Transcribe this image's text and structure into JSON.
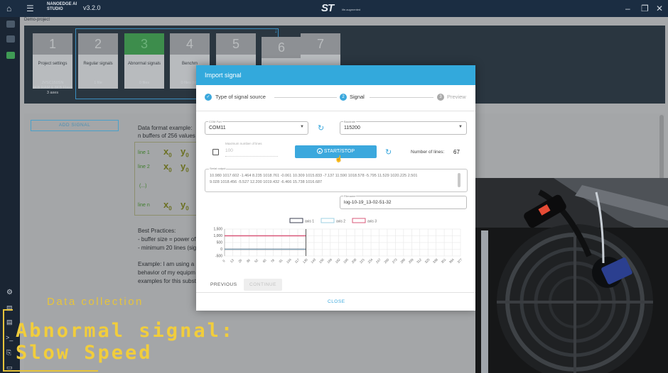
{
  "app": {
    "brand_line1": "NANOEDGE AI",
    "brand_line2": "STUDIO",
    "version": "v3.2.0",
    "logo_text": "ST",
    "logo_sub": "life.augmented"
  },
  "breadcrumb": "Demo-project",
  "steps": [
    {
      "num": "1",
      "label": "Project settings",
      "info": [
        "JVSC150SN",
        "8KB RAM & 8KB Flash",
        "3 axes"
      ]
    },
    {
      "num": "2",
      "label": "Regular signals",
      "info": [
        "1 file"
      ]
    },
    {
      "num": "3",
      "label": "Abnormal signals",
      "info": [
        "0 files"
      ]
    },
    {
      "num": "4",
      "label": "Benchm",
      "info": [
        "0 files (libr"
      ]
    },
    {
      "num": "5",
      "label": "",
      "info": []
    },
    {
      "num": "6",
      "label": "",
      "info": []
    },
    {
      "num": "7",
      "label": "",
      "info": []
    }
  ],
  "add_signal": "ADD SIGNAL",
  "background_text": {
    "format_title": "Data format example:",
    "format_desc": "n buffers of 256 values",
    "line1": "line 1",
    "line2": "line 2",
    "dots": "(...)",
    "linen": "line n",
    "x": "x",
    "y": "y",
    "sub0": "0",
    "best_practices": "Best Practices:",
    "bp1": "- buffer size = power of",
    "bp2": "- minimum 20 lines (sign",
    "example1": "Example: I am using a",
    "example2": "behavior of my equipm",
    "example3": "examples for this subst"
  },
  "dialog": {
    "title": "Import signal",
    "step1": "Type of signal source",
    "step2_num": "2",
    "step2": "Signal",
    "step3_num": "3",
    "step3": "Preview",
    "port_label": "COM Port",
    "port_value": "COM11",
    "baud_label": "Baudrate",
    "baud_value": "115200",
    "max_lines_label": "Maximum number of lines",
    "max_lines_value": "100",
    "start_stop": "START/STOP",
    "num_lines_label": "Number of lines:",
    "num_lines_value": "67",
    "serial_label": "Serial output",
    "serial_line1": "10.980 1017.602 -1.464 8.235 1018.761 -0.061 10.309 1015.833 -7.137 11.590 1018.578 -5.795 11.529 1020.225 2.501",
    "serial_line2": "9.028 1018.456 -5.527 12.200 1019.432 -6.466 15.738 1016.687",
    "filename_label": "Filename",
    "filename_value": "log-10-19_13-02-51-32",
    "previous": "PREVIOUS",
    "continue": "CONTINUE",
    "close": "CLOSE"
  },
  "chart_data": {
    "type": "line",
    "legend": [
      "axis 1",
      "axis 2",
      "axis 3"
    ],
    "colors": [
      "#3b3f52",
      "#9fd0e3",
      "#d9587a"
    ],
    "y_ticks": [
      "1,500",
      "1,000",
      "500",
      "0",
      "-500"
    ],
    "ylim": [
      -500,
      1500
    ],
    "x_ticks": [
      "0",
      "13",
      "26",
      "39",
      "52",
      "65",
      "78",
      "91",
      "104",
      "117",
      "130",
      "143",
      "156",
      "169",
      "182",
      "195",
      "208",
      "221",
      "234",
      "247",
      "260",
      "273",
      "286",
      "299",
      "312",
      "325",
      "338",
      "351",
      "364",
      "377"
    ],
    "series": [
      {
        "name": "axis 1",
        "x": [
          0,
          130
        ],
        "y": [
          0,
          0
        ]
      },
      {
        "name": "axis 2",
        "x": [
          0,
          130
        ],
        "y": [
          0,
          0
        ]
      },
      {
        "name": "axis 3",
        "x": [
          0,
          130
        ],
        "y": [
          1000,
          1000
        ]
      }
    ],
    "cursor_x": 130,
    "xlim": [
      0,
      377
    ]
  },
  "captions": {
    "top": "Data collection",
    "line1": "Abnormal signal:",
    "line2": "Slow Speed"
  }
}
